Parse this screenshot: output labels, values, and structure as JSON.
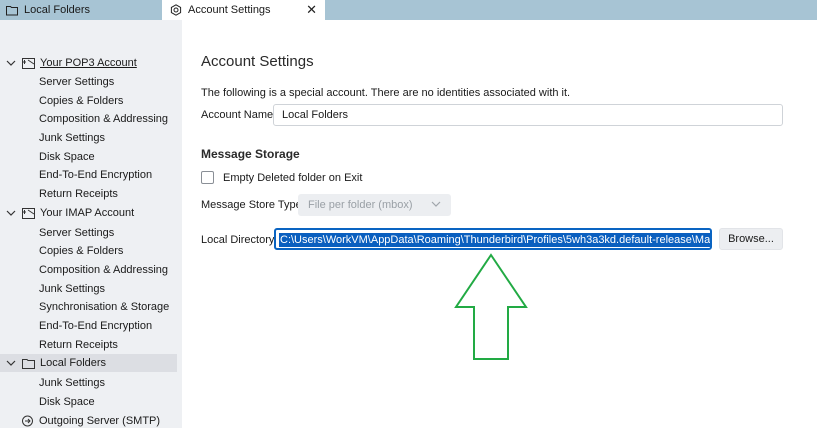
{
  "tabs": {
    "inactive_label": "Local Folders",
    "active_label": "Account Settings",
    "close_glyph": "✕"
  },
  "sidebar": {
    "pop3": {
      "label": "Your POP3 Account",
      "items": [
        "Server Settings",
        "Copies & Folders",
        "Composition & Addressing",
        "Junk Settings",
        "Disk Space",
        "End-To-End Encryption",
        "Return Receipts"
      ]
    },
    "imap": {
      "label": "Your IMAP Account",
      "items": [
        "Server Settings",
        "Copies & Folders",
        "Composition & Addressing",
        "Junk Settings",
        "Synchronisation & Storage",
        "End-To-End Encryption",
        "Return Receipts"
      ]
    },
    "local": {
      "label": "Local Folders",
      "items": [
        "Junk Settings",
        "Disk Space"
      ]
    },
    "smtp": {
      "label": "Outgoing Server (SMTP)"
    }
  },
  "main": {
    "title": "Account Settings",
    "note": "The following is a special account. There are no identities associated with it.",
    "account_name_label": "Account Name:",
    "account_name_value": "Local Folders",
    "storage_heading": "Message Storage",
    "empty_deleted_label": "Empty Deleted folder on Exit",
    "empty_deleted_checked": false,
    "store_type_label": "Message Store Type:",
    "store_type_value": "File per folder (mbox)",
    "local_dir_label": "Local Directory:",
    "local_dir_value": "C:\\Users\\WorkVM\\AppData\\Roaming\\Thunderbird\\Profiles\\5wh3a3kd.default-release\\Mail\\Local Folders",
    "browse_label": "Browse..."
  },
  "colors": {
    "tabbar": "#a7c4d4",
    "sidebar_bg": "#eef0f3",
    "selection_blue": "#0a5fbf",
    "annotation_arrow": "#22aa44"
  },
  "icons": {
    "tab_inactive": "folder-icon",
    "tab_active": "gear-icon",
    "pop3": "mail-account-icon",
    "imap": "mail-account-icon",
    "local": "folder-icon",
    "smtp": "outgoing-server-icon",
    "twisty": "chevron-down-icon"
  }
}
